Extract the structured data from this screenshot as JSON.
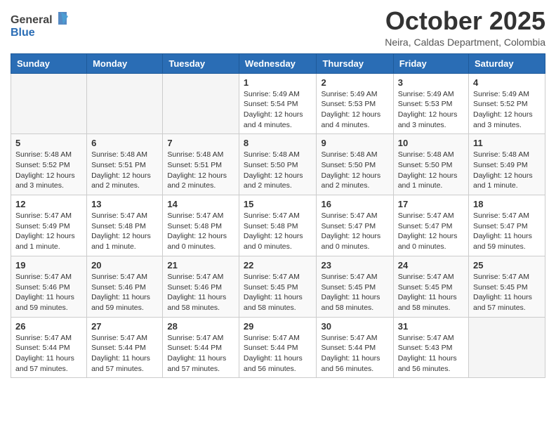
{
  "header": {
    "logo_general": "General",
    "logo_blue": "Blue",
    "month_title": "October 2025",
    "location": "Neira, Caldas Department, Colombia"
  },
  "weekdays": [
    "Sunday",
    "Monday",
    "Tuesday",
    "Wednesday",
    "Thursday",
    "Friday",
    "Saturday"
  ],
  "weeks": [
    [
      {
        "day": "",
        "info": ""
      },
      {
        "day": "",
        "info": ""
      },
      {
        "day": "",
        "info": ""
      },
      {
        "day": "1",
        "info": "Sunrise: 5:49 AM\nSunset: 5:54 PM\nDaylight: 12 hours\nand 4 minutes."
      },
      {
        "day": "2",
        "info": "Sunrise: 5:49 AM\nSunset: 5:53 PM\nDaylight: 12 hours\nand 4 minutes."
      },
      {
        "day": "3",
        "info": "Sunrise: 5:49 AM\nSunset: 5:53 PM\nDaylight: 12 hours\nand 3 minutes."
      },
      {
        "day": "4",
        "info": "Sunrise: 5:49 AM\nSunset: 5:52 PM\nDaylight: 12 hours\nand 3 minutes."
      }
    ],
    [
      {
        "day": "5",
        "info": "Sunrise: 5:48 AM\nSunset: 5:52 PM\nDaylight: 12 hours\nand 3 minutes."
      },
      {
        "day": "6",
        "info": "Sunrise: 5:48 AM\nSunset: 5:51 PM\nDaylight: 12 hours\nand 2 minutes."
      },
      {
        "day": "7",
        "info": "Sunrise: 5:48 AM\nSunset: 5:51 PM\nDaylight: 12 hours\nand 2 minutes."
      },
      {
        "day": "8",
        "info": "Sunrise: 5:48 AM\nSunset: 5:50 PM\nDaylight: 12 hours\nand 2 minutes."
      },
      {
        "day": "9",
        "info": "Sunrise: 5:48 AM\nSunset: 5:50 PM\nDaylight: 12 hours\nand 2 minutes."
      },
      {
        "day": "10",
        "info": "Sunrise: 5:48 AM\nSunset: 5:50 PM\nDaylight: 12 hours\nand 1 minute."
      },
      {
        "day": "11",
        "info": "Sunrise: 5:48 AM\nSunset: 5:49 PM\nDaylight: 12 hours\nand 1 minute."
      }
    ],
    [
      {
        "day": "12",
        "info": "Sunrise: 5:47 AM\nSunset: 5:49 PM\nDaylight: 12 hours\nand 1 minute."
      },
      {
        "day": "13",
        "info": "Sunrise: 5:47 AM\nSunset: 5:48 PM\nDaylight: 12 hours\nand 1 minute."
      },
      {
        "day": "14",
        "info": "Sunrise: 5:47 AM\nSunset: 5:48 PM\nDaylight: 12 hours\nand 0 minutes."
      },
      {
        "day": "15",
        "info": "Sunrise: 5:47 AM\nSunset: 5:48 PM\nDaylight: 12 hours\nand 0 minutes."
      },
      {
        "day": "16",
        "info": "Sunrise: 5:47 AM\nSunset: 5:47 PM\nDaylight: 12 hours\nand 0 minutes."
      },
      {
        "day": "17",
        "info": "Sunrise: 5:47 AM\nSunset: 5:47 PM\nDaylight: 12 hours\nand 0 minutes."
      },
      {
        "day": "18",
        "info": "Sunrise: 5:47 AM\nSunset: 5:47 PM\nDaylight: 11 hours\nand 59 minutes."
      }
    ],
    [
      {
        "day": "19",
        "info": "Sunrise: 5:47 AM\nSunset: 5:46 PM\nDaylight: 11 hours\nand 59 minutes."
      },
      {
        "day": "20",
        "info": "Sunrise: 5:47 AM\nSunset: 5:46 PM\nDaylight: 11 hours\nand 59 minutes."
      },
      {
        "day": "21",
        "info": "Sunrise: 5:47 AM\nSunset: 5:46 PM\nDaylight: 11 hours\nand 58 minutes."
      },
      {
        "day": "22",
        "info": "Sunrise: 5:47 AM\nSunset: 5:45 PM\nDaylight: 11 hours\nand 58 minutes."
      },
      {
        "day": "23",
        "info": "Sunrise: 5:47 AM\nSunset: 5:45 PM\nDaylight: 11 hours\nand 58 minutes."
      },
      {
        "day": "24",
        "info": "Sunrise: 5:47 AM\nSunset: 5:45 PM\nDaylight: 11 hours\nand 58 minutes."
      },
      {
        "day": "25",
        "info": "Sunrise: 5:47 AM\nSunset: 5:45 PM\nDaylight: 11 hours\nand 57 minutes."
      }
    ],
    [
      {
        "day": "26",
        "info": "Sunrise: 5:47 AM\nSunset: 5:44 PM\nDaylight: 11 hours\nand 57 minutes."
      },
      {
        "day": "27",
        "info": "Sunrise: 5:47 AM\nSunset: 5:44 PM\nDaylight: 11 hours\nand 57 minutes."
      },
      {
        "day": "28",
        "info": "Sunrise: 5:47 AM\nSunset: 5:44 PM\nDaylight: 11 hours\nand 57 minutes."
      },
      {
        "day": "29",
        "info": "Sunrise: 5:47 AM\nSunset: 5:44 PM\nDaylight: 11 hours\nand 56 minutes."
      },
      {
        "day": "30",
        "info": "Sunrise: 5:47 AM\nSunset: 5:44 PM\nDaylight: 11 hours\nand 56 minutes."
      },
      {
        "day": "31",
        "info": "Sunrise: 5:47 AM\nSunset: 5:43 PM\nDaylight: 11 hours\nand 56 minutes."
      },
      {
        "day": "",
        "info": ""
      }
    ]
  ]
}
